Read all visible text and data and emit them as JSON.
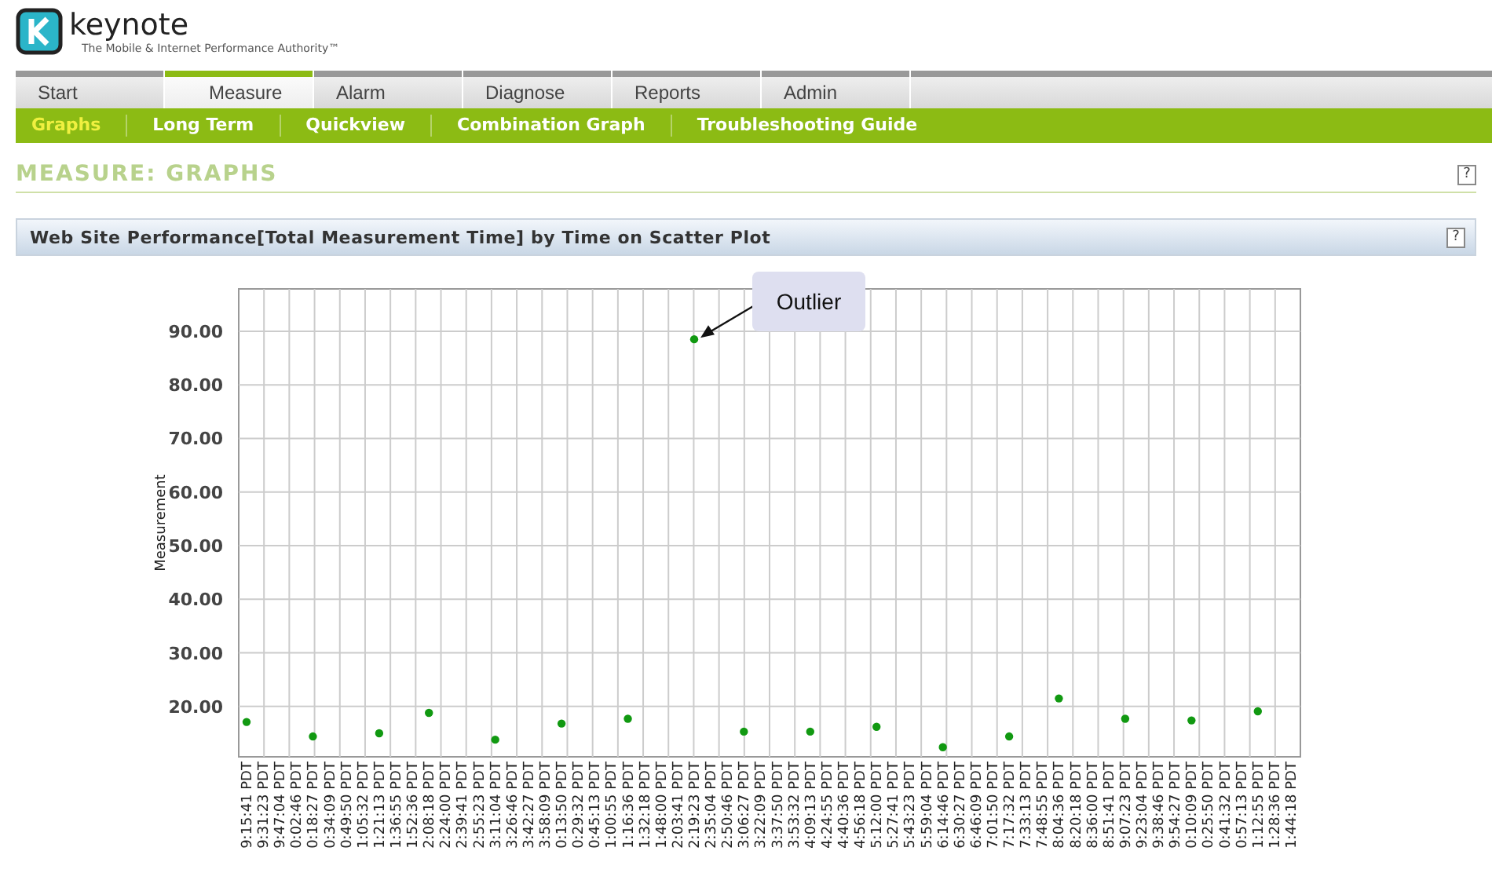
{
  "brand": {
    "name": "keynote",
    "tagline": "The Mobile & Internet Performance Authority™"
  },
  "tabs": [
    {
      "label": "Start",
      "selected": false
    },
    {
      "label": "Measure",
      "selected": true
    },
    {
      "label": "Alarm",
      "selected": false
    },
    {
      "label": "Diagnose",
      "selected": false
    },
    {
      "label": "Reports",
      "selected": false
    },
    {
      "label": "Admin",
      "selected": false
    }
  ],
  "subtabs": [
    {
      "label": "Graphs",
      "selected": true
    },
    {
      "label": "Long Term",
      "selected": false
    },
    {
      "label": "Quickview",
      "selected": false
    },
    {
      "label": "Combination Graph",
      "selected": false
    },
    {
      "label": "Troubleshooting Guide",
      "selected": false
    }
  ],
  "page_heading": {
    "title": "MEASURE: GRAPHS",
    "help": "?"
  },
  "panel": {
    "title": "Web Site Performance[Total Measurement Time] by Time on Scatter Plot",
    "help": "?",
    "chart_data": {
      "type": "scatter",
      "ylabel": "Measurement",
      "categories": [
        "9:15:41 PDT",
        "9:31:23 PDT",
        "9:47:04 PDT",
        "0:02:46 PDT",
        "0:18:27 PDT",
        "0:34:09 PDT",
        "0:49:50 PDT",
        "1:05:32 PDT",
        "1:21:13 PDT",
        "1:36:55 PDT",
        "1:52:36 PDT",
        "2:08:18 PDT",
        "2:24:00 PDT",
        "2:39:41 PDT",
        "2:55:23 PDT",
        "3:11:04 PDT",
        "3:26:46 PDT",
        "3:42:27 PDT",
        "3:58:09 PDT",
        "0:13:50 PDT",
        "0:29:32 PDT",
        "0:45:13 PDT",
        "1:00:55 PDT",
        "1:16:36 PDT",
        "1:32:18 PDT",
        "1:48:00 PDT",
        "2:03:41 PDT",
        "2:19:23 PDT",
        "2:35:04 PDT",
        "2:50:46 PDT",
        "3:06:27 PDT",
        "3:22:09 PDT",
        "3:37:50 PDT",
        "3:53:32 PDT",
        "4:09:13 PDT",
        "4:24:55 PDT",
        "4:40:36 PDT",
        "4:56:18 PDT",
        "5:12:00 PDT",
        "5:27:41 PDT",
        "5:43:23 PDT",
        "5:59:04 PDT",
        "6:14:46 PDT",
        "6:30:27 PDT",
        "6:46:09 PDT",
        "7:01:50 PDT",
        "7:17:32 PDT",
        "7:33:13 PDT",
        "7:48:55 PDT",
        "8:04:36 PDT",
        "8:20:18 PDT",
        "8:36:00 PDT",
        "8:51:41 PDT",
        "9:07:23 PDT",
        "9:23:04 PDT",
        "9:38:46 PDT",
        "9:54:27 PDT",
        "0:10:09 PDT",
        "0:25:50 PDT",
        "0:41:32 PDT",
        "0:57:13 PDT",
        "1:12:55 PDT",
        "1:28:36 PDT",
        "1:44:18 PDT"
      ],
      "grid": true,
      "values": [
        17.1,
        null,
        null,
        null,
        14.4,
        null,
        null,
        null,
        15.0,
        null,
        null,
        18.8,
        null,
        null,
        null,
        13.8,
        null,
        null,
        null,
        16.8,
        null,
        null,
        null,
        17.7,
        null,
        null,
        null,
        88.5,
        null,
        null,
        15.3,
        null,
        null,
        null,
        15.3,
        null,
        null,
        null,
        16.2,
        null,
        null,
        null,
        12.4,
        null,
        null,
        null,
        14.4,
        null,
        null,
        21.5,
        null,
        null,
        null,
        17.7,
        null,
        null,
        null,
        17.4,
        null,
        null,
        null,
        19.1,
        null,
        null
      ],
      "ylim": [
        10.6,
        97.9
      ],
      "yticks": [
        {
          "value": 20,
          "label": "20.00"
        },
        {
          "value": 30,
          "label": "30.00"
        },
        {
          "value": 40,
          "label": "40.00"
        },
        {
          "value": 50,
          "label": "50.00"
        },
        {
          "value": 60,
          "label": "60.00"
        },
        {
          "value": 70,
          "label": "70.00"
        },
        {
          "value": 80,
          "label": "80.00"
        },
        {
          "value": 90,
          "label": "90.00"
        }
      ],
      "annotations": [
        {
          "text": "Outlier",
          "x": "2:19:23 PDT",
          "y": 88.5
        }
      ]
    }
  }
}
